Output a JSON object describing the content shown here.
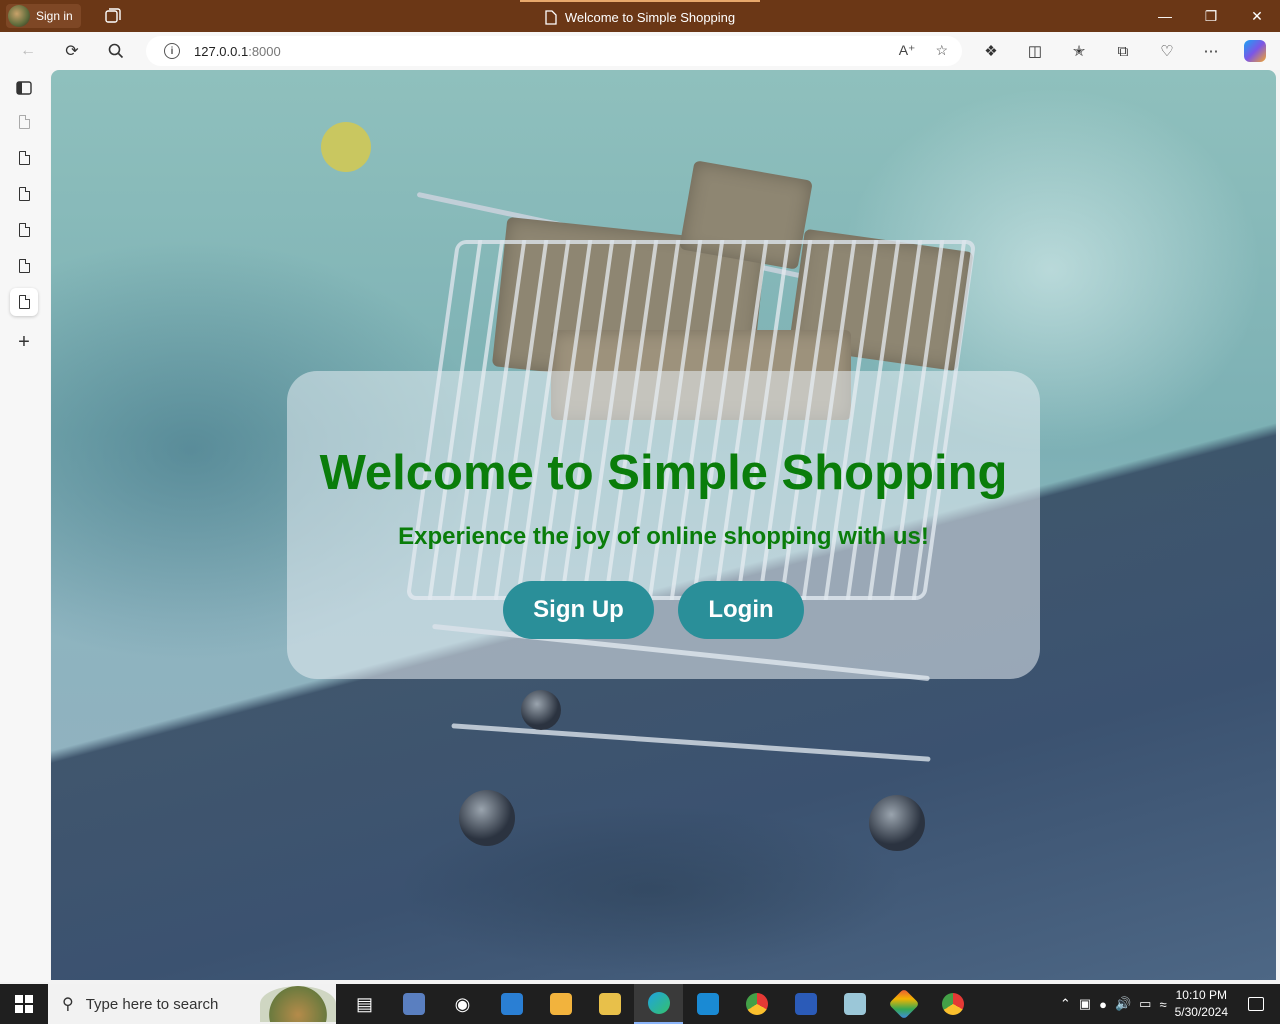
{
  "browser": {
    "profile_label": "Sign in",
    "tab_title": "Welcome to Simple Shopping",
    "url_host": "127.0.0.1",
    "url_port": ":8000"
  },
  "page": {
    "heading": "Welcome to Simple Shopping",
    "subheading": "Experience the joy of online shopping with us!",
    "signup_label": "Sign Up",
    "login_label": "Login"
  },
  "taskbar": {
    "search_placeholder": "Type here to search",
    "time": "10:10 PM",
    "date": "5/30/2024"
  },
  "colors": {
    "titlebar": "#6b3716",
    "heading": "#0a7d0a",
    "button": "#2a8f99"
  }
}
